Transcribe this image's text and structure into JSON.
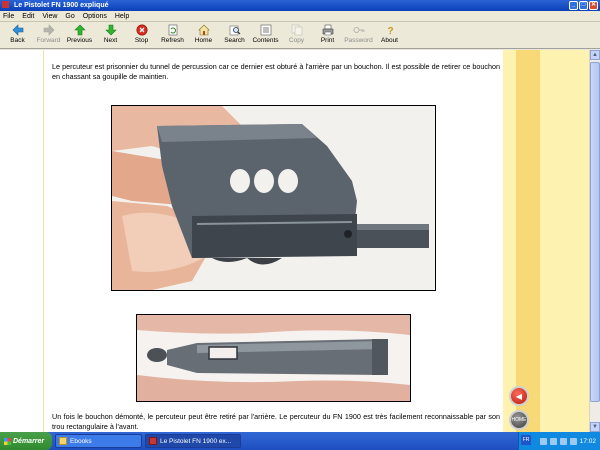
{
  "window": {
    "title": "Le Pistolet FN 1900 expliqué"
  },
  "menu": {
    "items": [
      "File",
      "Edit",
      "View",
      "Go",
      "Options",
      "Help"
    ]
  },
  "toolbar": {
    "buttons": [
      {
        "label": "Back",
        "icon": "back-arrow-icon",
        "enabled": true
      },
      {
        "label": "Forward",
        "icon": "forward-arrow-icon",
        "enabled": false
      },
      {
        "label": "Previous",
        "icon": "previous-arrow-icon",
        "enabled": true
      },
      {
        "label": "Next",
        "icon": "next-arrow-icon",
        "enabled": true
      },
      {
        "label": "Stop",
        "icon": "stop-icon",
        "enabled": true
      },
      {
        "label": "Refresh",
        "icon": "refresh-icon",
        "enabled": true
      },
      {
        "label": "Home",
        "icon": "home-icon",
        "enabled": true
      },
      {
        "label": "Search",
        "icon": "search-icon",
        "enabled": true
      },
      {
        "label": "Contents",
        "icon": "contents-icon",
        "enabled": true
      },
      {
        "label": "Copy",
        "icon": "copy-icon",
        "enabled": false
      },
      {
        "label": "Print",
        "icon": "print-icon",
        "enabled": true
      },
      {
        "label": "Password",
        "icon": "key-icon",
        "enabled": false
      },
      {
        "label": "About",
        "icon": "about-icon",
        "enabled": true
      }
    ]
  },
  "content": {
    "paragraph_top": "Le percuteur est prisonnier du tunnel de percussion car ce dernier est obturé à l'arrière par un bouchon. Il est possible de retirer ce bouchon en chassant sa goupille de maintien.",
    "paragraph_bottom": "Un fois le bouchon démonté, le percuteur peut être retiré par l'arrière. Le percuteur du FN 1900 est très facilement reconnaissable par son trou rectangulaire à l'avant."
  },
  "nav": {
    "home_label": "HOME"
  },
  "taskbar": {
    "start_label": "Démarrer",
    "tasks": [
      {
        "label": "Ebooks",
        "active": false
      },
      {
        "label": "Le Pistolet FN 1900 ex...",
        "active": true
      }
    ],
    "lang": "FR",
    "clock": "17:02"
  },
  "colors": {
    "titlebar": "#0a3fb8",
    "page_bg": "#ffffff",
    "right_band": "#fdf2b0",
    "right_band_dark": "#f7d978",
    "taskbar": "#1e4fc0"
  }
}
